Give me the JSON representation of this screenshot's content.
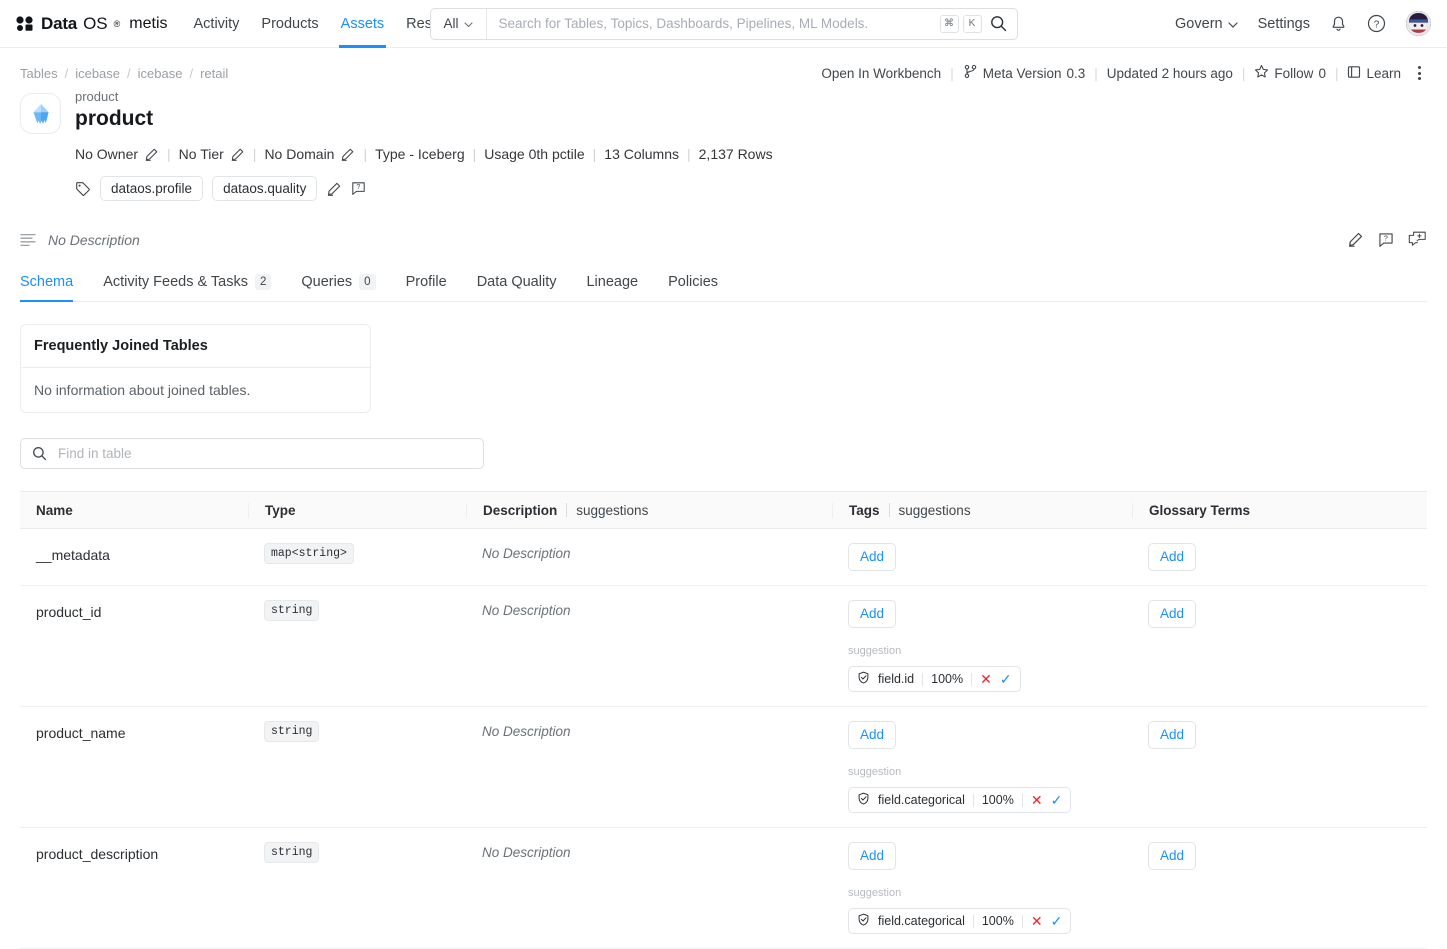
{
  "brand": {
    "data": "Data",
    "os": "OS",
    "sup": "®",
    "metis": "metis"
  },
  "nav": {
    "items": [
      {
        "label": "Activity",
        "active": false
      },
      {
        "label": "Products",
        "active": false
      },
      {
        "label": "Assets",
        "active": true
      },
      {
        "label": "Resources",
        "active": false
      }
    ]
  },
  "search": {
    "scope": "All",
    "placeholder": "Search for Tables, Topics, Dashboards, Pipelines, ML Models.",
    "value": "",
    "kbd_cmd": "⌘",
    "kbd_k": "K"
  },
  "topnav_right": {
    "govern": "Govern",
    "settings": "Settings"
  },
  "breadcrumb": {
    "items": [
      "Tables",
      "icebase",
      "icebase",
      "retail"
    ],
    "separator": "/"
  },
  "actions": {
    "open_in_workbench": "Open In Workbench",
    "meta_version_label": "Meta Version",
    "meta_version_value": "0.3",
    "updated": "Updated 2 hours ago",
    "follow_label": "Follow",
    "follow_count": "0",
    "learn": "Learn"
  },
  "entity": {
    "supertitle": "product",
    "title": "product",
    "meta": [
      {
        "label": "No Owner",
        "editable": true
      },
      {
        "label": "No Tier",
        "editable": true
      },
      {
        "label": "No Domain",
        "editable": true
      },
      {
        "label": "Type -  Iceberg",
        "editable": false
      },
      {
        "label": "Usage 0th pctile",
        "editable": false
      },
      {
        "label": "13 Columns",
        "editable": false
      },
      {
        "label": "2,137 Rows",
        "editable": false
      }
    ],
    "tags": [
      "dataos.profile",
      "dataos.quality"
    ]
  },
  "description": {
    "text": "No Description"
  },
  "tabs": [
    {
      "label": "Schema",
      "badge": null,
      "active": true
    },
    {
      "label": "Activity Feeds & Tasks",
      "badge": "2",
      "active": false
    },
    {
      "label": "Queries",
      "badge": "0",
      "active": false
    },
    {
      "label": "Profile",
      "badge": null,
      "active": false
    },
    {
      "label": "Data Quality",
      "badge": null,
      "active": false
    },
    {
      "label": "Lineage",
      "badge": null,
      "active": false
    },
    {
      "label": "Policies",
      "badge": null,
      "active": false
    }
  ],
  "joined_tables": {
    "title": "Frequently Joined Tables",
    "empty": "No information about joined tables."
  },
  "find_in_table": {
    "placeholder": "Find in table",
    "value": ""
  },
  "schema_table": {
    "headers": {
      "name": "Name",
      "type": "Type",
      "description": "Description",
      "description_sub": "suggestions",
      "tags": "Tags",
      "tags_sub": "suggestions",
      "glossary": "Glossary Terms"
    },
    "add_label": "Add",
    "suggestion_label": "suggestion",
    "rows": [
      {
        "name": "__metadata",
        "type": "map<string>",
        "description": "No Description",
        "tag_suggestion": null,
        "tag_confidence": null
      },
      {
        "name": "product_id",
        "type": "string",
        "description": "No Description",
        "tag_suggestion": "field.id",
        "tag_confidence": "100%"
      },
      {
        "name": "product_name",
        "type": "string",
        "description": "No Description",
        "tag_suggestion": "field.categorical",
        "tag_confidence": "100%"
      },
      {
        "name": "product_description",
        "type": "string",
        "description": "No Description",
        "tag_suggestion": "field.categorical",
        "tag_confidence": "100%"
      }
    ]
  },
  "colors": {
    "accent": "#1890ff",
    "reject": "#f5222d",
    "text": "#41464b",
    "muted": "#6b7177"
  }
}
